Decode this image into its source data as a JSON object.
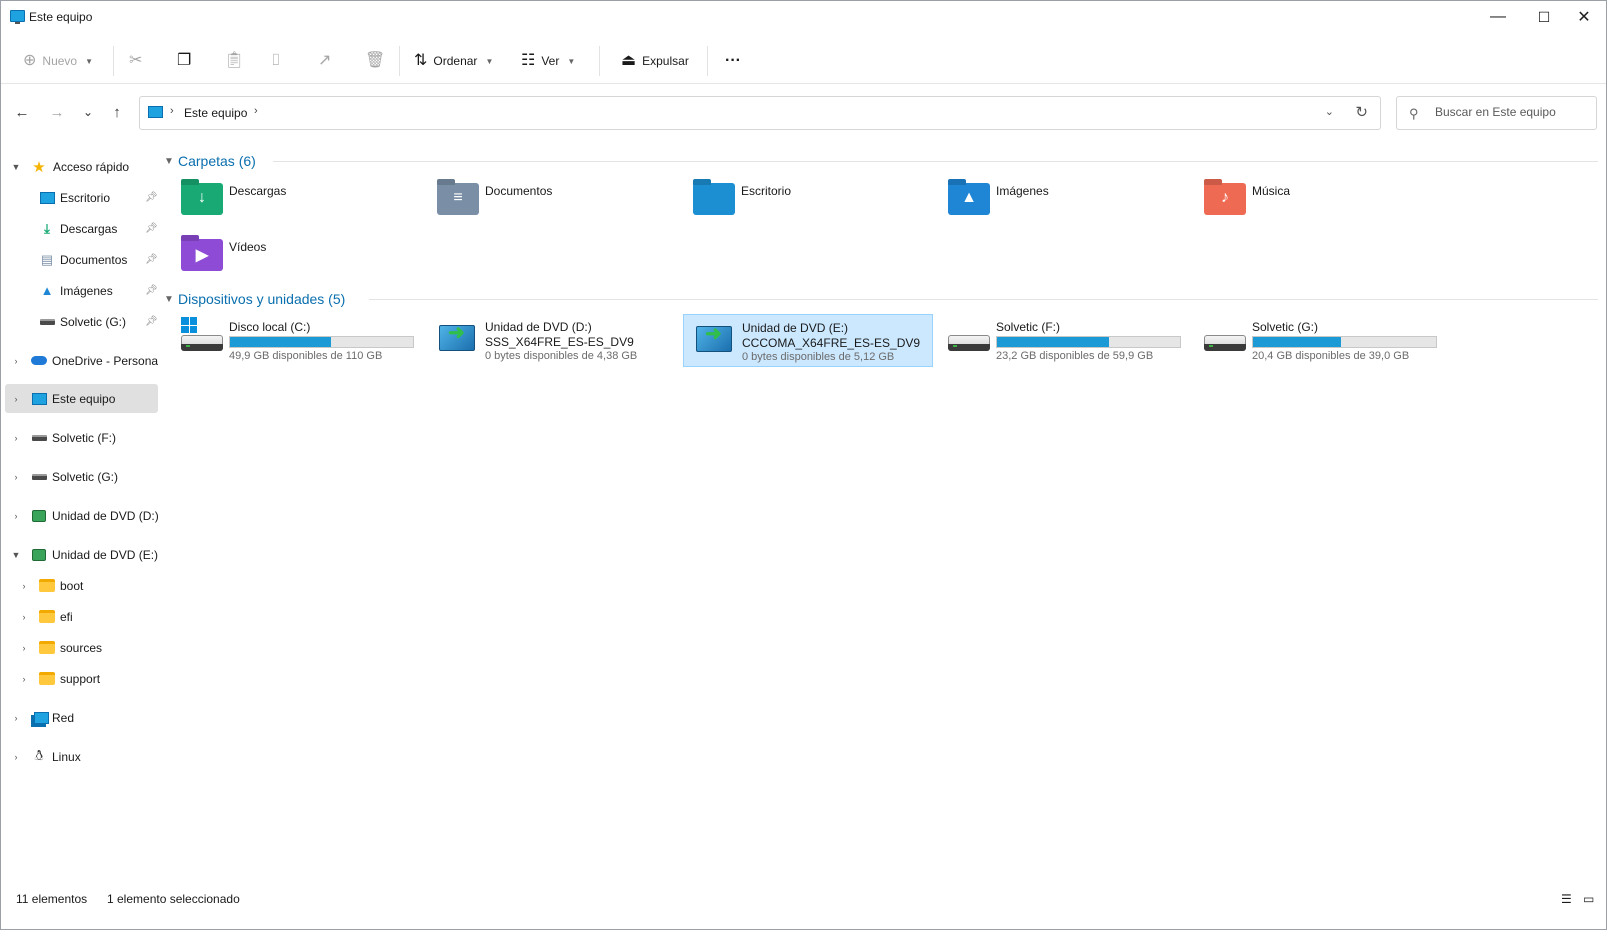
{
  "window": {
    "title": "Este equipo",
    "controls": {
      "minimize": "—",
      "maximize": "☐",
      "close": "✕"
    }
  },
  "toolbar": {
    "new_label": "Nuevo",
    "sort_label": "Ordenar",
    "view_label": "Ver",
    "eject_label": "Expulsar",
    "more_label": "···"
  },
  "nav": {
    "back": "←",
    "forward": "→",
    "recent": "⌄",
    "up": "↑"
  },
  "address": {
    "crumb": "Este equipo",
    "separator": "›"
  },
  "search": {
    "placeholder": "Buscar en Este equipo"
  },
  "sidebar": {
    "items": [
      {
        "label": "Acceso rápido",
        "icon": "star-icon"
      },
      {
        "label": "Escritorio",
        "icon": "desktop-icon",
        "pinned": true
      },
      {
        "label": "Descargas",
        "icon": "download-icon",
        "pinned": true
      },
      {
        "label": "Documentos",
        "icon": "document-icon",
        "pinned": true
      },
      {
        "label": "Imágenes",
        "icon": "image-icon",
        "pinned": true
      },
      {
        "label": "Solvetic (G:)",
        "icon": "drive-icon",
        "pinned": true
      },
      {
        "label": "OneDrive - Personal",
        "icon": "cloud-icon"
      },
      {
        "label": "Este equipo",
        "icon": "pc-icon",
        "selected": true
      },
      {
        "label": "Solvetic (F:)",
        "icon": "drive-icon"
      },
      {
        "label": "Solvetic (G:)",
        "icon": "drive-icon"
      },
      {
        "label": "Unidad de DVD (D:)",
        "icon": "dvd-icon"
      },
      {
        "label": "Unidad de DVD (E:) C",
        "icon": "dvd-icon"
      },
      {
        "label": "boot",
        "icon": "folder-icon"
      },
      {
        "label": "efi",
        "icon": "folder-icon"
      },
      {
        "label": "sources",
        "icon": "folder-icon"
      },
      {
        "label": "support",
        "icon": "folder-icon"
      },
      {
        "label": "Red",
        "icon": "network-icon"
      },
      {
        "label": "Linux",
        "icon": "linux-icon"
      }
    ]
  },
  "folders_section": {
    "title": "Carpetas (6)",
    "items": [
      {
        "name": "Descargas",
        "color": "#19a974",
        "glyph": "↓"
      },
      {
        "name": "Documentos",
        "color": "#7a8fa6",
        "glyph": "≡"
      },
      {
        "name": "Escritorio",
        "color": "#1b8fd1",
        "glyph": ""
      },
      {
        "name": "Imágenes",
        "color": "#1f86d6",
        "glyph": "▲"
      },
      {
        "name": "Música",
        "color": "#ef6a52",
        "glyph": "♪"
      },
      {
        "name": "Vídeos",
        "color": "#8e4bd6",
        "glyph": "▶"
      }
    ]
  },
  "devices_section": {
    "title": "Dispositivos y unidades (5)",
    "items": [
      {
        "name": "Disco local (C:)",
        "type": "hdd-system",
        "used_fraction": 0.55,
        "free": "49,9 GB disponibles de 110 GB"
      },
      {
        "name": "Unidad de DVD (D:)",
        "type": "dvd",
        "label": "SSS_X64FRE_ES-ES_DV9",
        "free": "0 bytes disponibles de 4,38 GB"
      },
      {
        "name": "Unidad de DVD (E:)",
        "type": "dvd",
        "label": "CCCOMA_X64FRE_ES-ES_DV9",
        "free": "0 bytes disponibles de 5,12 GB",
        "selected": true
      },
      {
        "name": "Solvetic (F:)",
        "type": "hdd",
        "used_fraction": 0.61,
        "free": "23,2 GB disponibles de 59,9 GB"
      },
      {
        "name": "Solvetic (G:)",
        "type": "hdd",
        "used_fraction": 0.48,
        "free": "20,4 GB disponibles de 39,0 GB"
      }
    ]
  },
  "status": {
    "count": "11 elementos",
    "selection": "1 elemento seleccionado"
  },
  "colors": {
    "accent": "#0a6fae",
    "selection": "#cce8ff",
    "progress": "#1b9ad6"
  }
}
